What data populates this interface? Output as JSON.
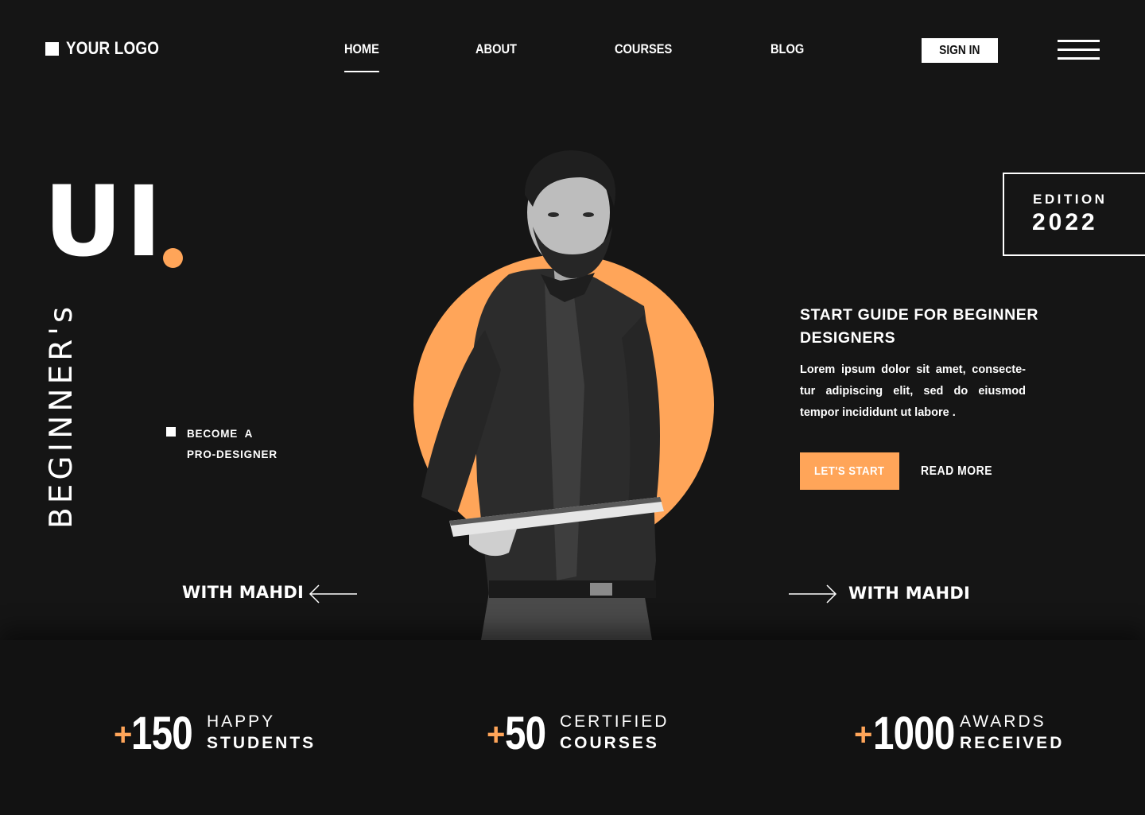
{
  "nav": {
    "logo_text": "YOUR LOGO",
    "items": [
      {
        "label": "HOME",
        "active": true
      },
      {
        "label": "ABOUT",
        "active": false
      },
      {
        "label": "COURSES",
        "active": false
      },
      {
        "label": "BLOG",
        "active": false
      }
    ],
    "signin_label": "SIGN IN",
    "menu_icon": "hamburger-icon"
  },
  "hero": {
    "big_title": "UI",
    "vertical_text": "BEGINNER's",
    "become_line1": "BECOME  A",
    "become_line2": "PRO-DESIGNER",
    "with_left": "WITH MAHDI",
    "with_right": "WITH MAHDI",
    "edition_label": "EDITION",
    "edition_year": "2022"
  },
  "guide": {
    "title": "START GUIDE FOR BEGINNER DESIGNERS",
    "body": "Lorem ipsum dolor sit amet, consecte-tur adipiscing elit, sed do eiusmod tempor incididunt ut labore .",
    "cta_label": "LET'S START",
    "readmore_label": "READ MORE"
  },
  "stats": [
    {
      "plus": "+",
      "value": "150",
      "line1": "HAPPY",
      "line2": "STUDENTS"
    },
    {
      "plus": "+",
      "value": "50",
      "line1": "CERTIFIED",
      "line2": "COURSES"
    },
    {
      "plus": "+",
      "value": "1000",
      "line1": "AWARDS",
      "line2": "RECEIVED"
    }
  ],
  "colors": {
    "background": "#151515",
    "accent": "#ffa559",
    "text": "#ffffff"
  }
}
